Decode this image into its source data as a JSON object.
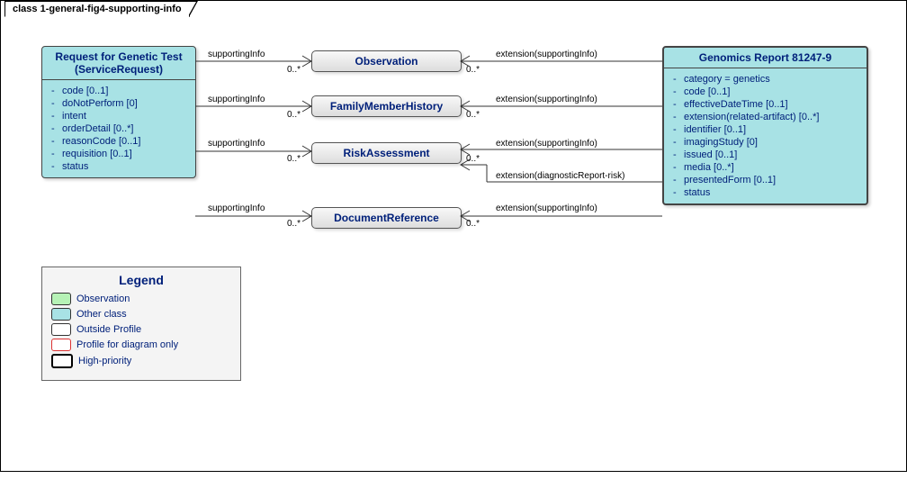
{
  "tab_title": "class 1-general-fig4-supporting-info",
  "leftClass": {
    "title": "Request for Genetic Test (ServiceRequest)",
    "attrs": [
      "code [0..1]",
      "doNotPerform [0]",
      "intent",
      "orderDetail [0..*]",
      "reasonCode [0..1]",
      "requisition [0..1]",
      "status"
    ]
  },
  "rightClass": {
    "title": "Genomics Report 81247-9",
    "attrs": [
      "category = genetics",
      "code [0..1]",
      "effectiveDateTime [0..1]",
      "extension(related-artifact) [0..*]",
      "identifier [0..1]",
      "imagingStudy [0]",
      "issued [0..1]",
      "media [0..*]",
      "presentedForm [0..1]",
      "status"
    ]
  },
  "midBoxes": {
    "observation": "Observation",
    "fmh": "FamilyMemberHistory",
    "risk": "RiskAssessment",
    "docref": "DocumentReference"
  },
  "relLabels": {
    "supportingInfo": "supportingInfo",
    "extSupporting": "extension(supportingInfo)",
    "extDiagRisk": "extension(diagnosticReport-risk)",
    "mult": "0..*"
  },
  "legend": {
    "title": "Legend",
    "items": {
      "observation": "Observation",
      "other": "Other class",
      "outside": "Outside Profile",
      "profile": "Profile for diagram only",
      "hp": "High-priority"
    }
  }
}
